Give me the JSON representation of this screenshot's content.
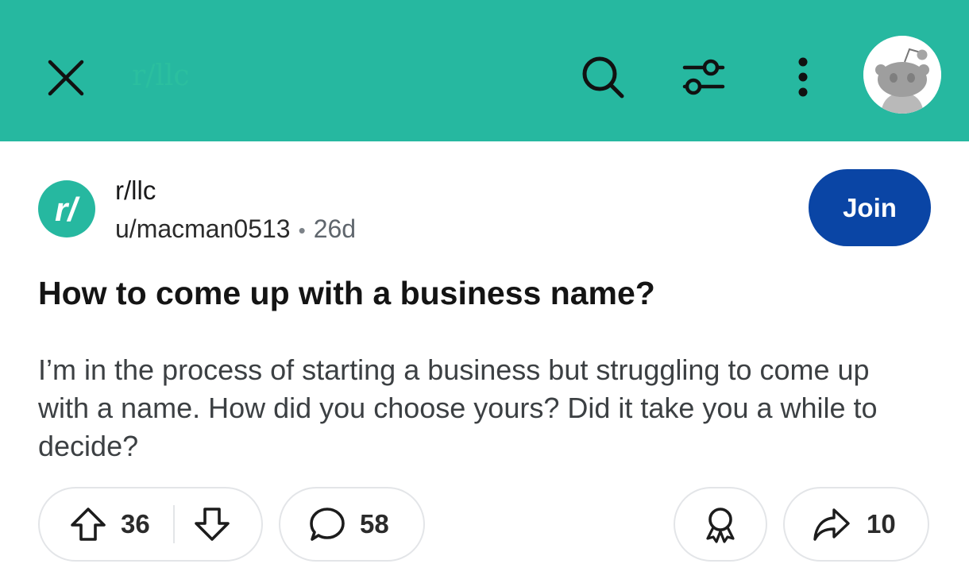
{
  "header": {
    "title": "r/llc",
    "background_color": "#26b8a0",
    "icons": [
      "close-icon",
      "search-icon",
      "filter-icon",
      "more-icon",
      "avatar"
    ]
  },
  "post": {
    "subreddit": "r/llc",
    "subreddit_logo_text": "r/",
    "author": "u/macman0513",
    "separator": "•",
    "age": "26d",
    "join_label": "Join",
    "join_color": "#0a45a5",
    "title": "How to come up with a business name?",
    "body": "I’m in the process of starting a business but struggling to come up with a name. How did you choose yours? Did it take you a while to decide?"
  },
  "actions": {
    "upvotes": "36",
    "comments": "58",
    "shares": "10"
  }
}
